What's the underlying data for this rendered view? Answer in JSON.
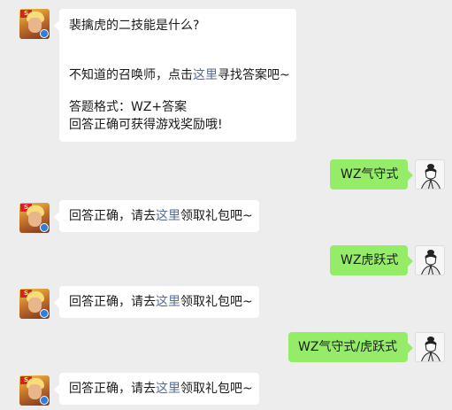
{
  "messages": [
    {
      "question": "裴擒虎的二技能是什么?",
      "hint_before": "不知道的召唤师，点击",
      "hint_link": "这里",
      "hint_after": "寻找答案吧~",
      "format": "答题格式：WZ+答案",
      "reward": "回答正确可获得游戏奖励哦!"
    },
    {
      "text": "WZ气守式"
    },
    {
      "before": "回答正确，请去",
      "link": "这里",
      "after": "领取礼包吧~"
    },
    {
      "text": "WZ虎跃式"
    },
    {
      "before": "回答正确，请去",
      "link": "这里",
      "after": "领取礼包吧~"
    },
    {
      "text": "WZ气守式/虎跃式"
    },
    {
      "before": "回答正确，请去",
      "link": "这里",
      "after": "领取礼包吧~"
    }
  ],
  "colors": {
    "background": "#ededed",
    "bot_bubble": "#ffffff",
    "user_bubble": "#95ec69",
    "link": "#576b95"
  },
  "icons": {
    "bot_avatar": "hero-avatar-icon",
    "user_avatar": "ink-portrait-avatar-icon"
  }
}
